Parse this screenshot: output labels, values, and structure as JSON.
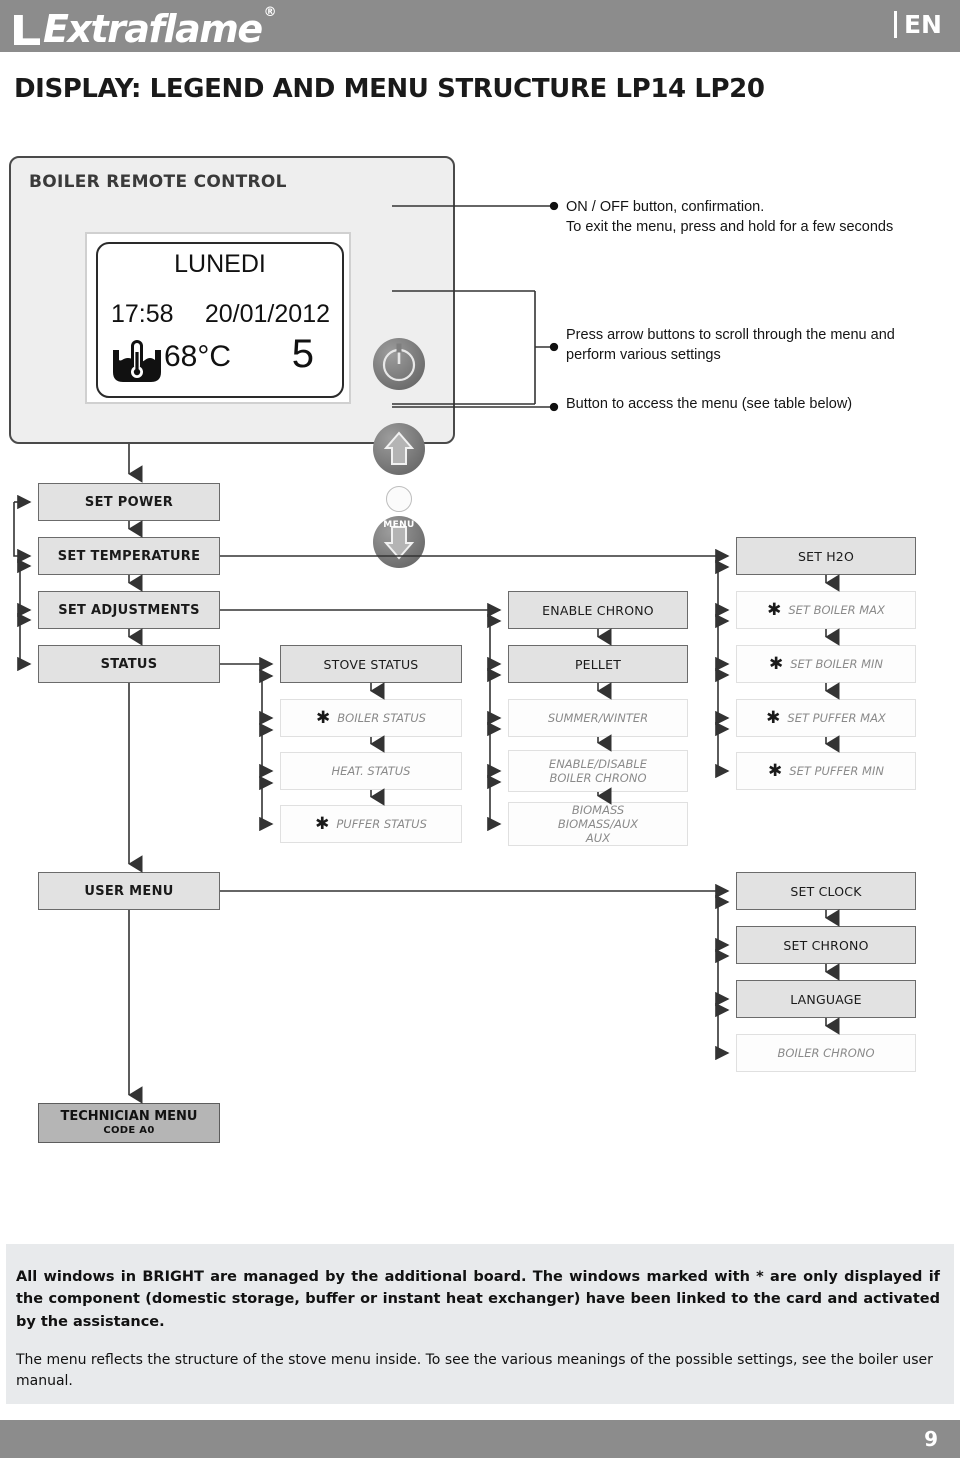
{
  "header": {
    "brand": "Extraflame",
    "registered_mark": "®",
    "language": "EN",
    "language_divider": "|"
  },
  "page_title": "DISPLAY: LEGEND AND MENU STRUCTURE LP14 LP20",
  "remote": {
    "panel_title": "BOILER REMOTE CONTROL",
    "display": {
      "day": "LUNEDI",
      "time": "17:58",
      "date": "20/01/2012",
      "temperature": "68°C",
      "power_level": "5",
      "boiler_icon": "boiler-thermometer-icon"
    },
    "buttons": {
      "power": "power-icon",
      "up": "arrow-up-icon",
      "down": "arrow-down-icon",
      "menu_label": "MENU",
      "led": "led-indicator"
    }
  },
  "callouts": [
    {
      "line1": "ON / OFF button, confirmation.",
      "line2": "To exit the menu, press and hold for a few seconds"
    },
    {
      "line1": "Press arrow buttons to scroll through the menu and",
      "line2": "perform various settings"
    },
    {
      "line1": "Button to access the menu (see table below)",
      "line2": ""
    }
  ],
  "flowchart": {
    "column1": [
      {
        "label": "SET POWER",
        "style": "bold"
      },
      {
        "label": "SET TEMPERATURE",
        "style": "bold"
      },
      {
        "label": "SET ADJUSTMENTS",
        "style": "bold"
      },
      {
        "label": "STATUS",
        "style": "bold"
      },
      {
        "label": "USER MENU",
        "style": "bold"
      },
      {
        "label": "TECHNICIAN MENU",
        "sublabel": "CODE A0",
        "style": "dark"
      }
    ],
    "column2": [
      {
        "label": "STOVE STATUS",
        "style": "plain",
        "asterisk": false
      },
      {
        "label": "BOILER STATUS",
        "style": "light",
        "asterisk": true
      },
      {
        "label": "HEAT. STATUS",
        "style": "light",
        "asterisk": false
      },
      {
        "label": "PUFFER STATUS",
        "style": "light",
        "asterisk": true
      }
    ],
    "column3": [
      {
        "label": "ENABLE CHRONO",
        "style": "plain",
        "asterisk": false
      },
      {
        "label": "PELLET",
        "style": "plain",
        "asterisk": false
      },
      {
        "label": "SUMMER/WINTER",
        "style": "light",
        "asterisk": false
      },
      {
        "label": "ENABLE/DISABLE\nBOILER CHRONO",
        "style": "light",
        "asterisk": false
      },
      {
        "label": "BIOMASS\nBIOMASS/AUX\nAUX",
        "style": "light",
        "asterisk": false
      }
    ],
    "column4": [
      {
        "label": "SET H2O",
        "style": "plain",
        "asterisk": false
      },
      {
        "label": "SET BOILER MAX",
        "style": "light",
        "asterisk": true
      },
      {
        "label": "SET BOILER MIN",
        "style": "light",
        "asterisk": true
      },
      {
        "label": "SET PUFFER MAX",
        "style": "light",
        "asterisk": true
      },
      {
        "label": "SET PUFFER MIN",
        "style": "light",
        "asterisk": true
      }
    ],
    "column5": [
      {
        "label": "SET CLOCK",
        "style": "plain",
        "asterisk": false
      },
      {
        "label": "SET CHRONO",
        "style": "plain",
        "asterisk": false
      },
      {
        "label": "LANGUAGE",
        "style": "plain",
        "asterisk": false
      },
      {
        "label": "BOILER CHRONO",
        "style": "light",
        "asterisk": false
      }
    ]
  },
  "footer": {
    "paragraph1": "All windows in BRIGHT are managed by the additional board. The windows marked with * are only displayed if the component (domestic storage, buffer or instant heat exchanger) have been linked to the card and activated by the assistance.",
    "paragraph2": "The menu reflects the structure of the stove menu inside. To see the various meanings of the possible settings, see the boiler user manual.",
    "page_number": "9"
  },
  "colors": {
    "header_gray": "#8c8c8c",
    "node_fill": "#e2e2e2",
    "node_border": "#6b6b6b",
    "light_node_fill": "#fdfdfd",
    "dark_node_fill": "#b5b5b5",
    "footer_fill": "#e8eaec"
  }
}
